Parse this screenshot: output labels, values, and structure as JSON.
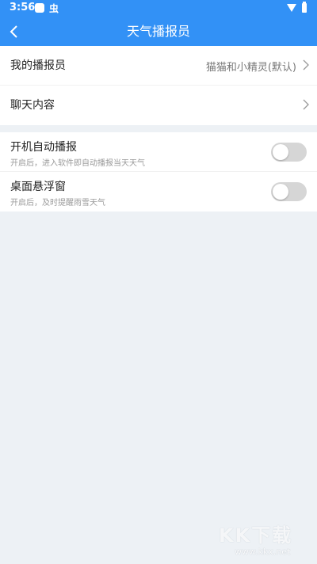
{
  "status_bar": {
    "time": "3:56",
    "bug_glyph": "虫",
    "icons": [
      "app-icon",
      "bug-icon",
      "wifi-icon",
      "battery-icon"
    ]
  },
  "app_bar": {
    "title": "天气播报员",
    "back_icon": "chevron-left-icon",
    "color": "#3291F6"
  },
  "settings": {
    "group1": [
      {
        "label": "我的播报员",
        "value": "猫猫和小精灵(默认)"
      },
      {
        "label": "聊天内容",
        "value": ""
      }
    ],
    "group2": [
      {
        "title": "开机自动播报",
        "desc": "开启后，进入软件即自动播报当天天气",
        "enabled": false
      },
      {
        "title": "桌面悬浮窗",
        "desc": "开启后，及时提醒雨雪天气",
        "enabled": false
      }
    ]
  },
  "watermark": {
    "logo": "KK下载",
    "url": "www.kkx.net"
  },
  "colors": {
    "accent": "#3291F6",
    "background": "#EDF1F5",
    "switch_off": "#D6D6D6"
  }
}
